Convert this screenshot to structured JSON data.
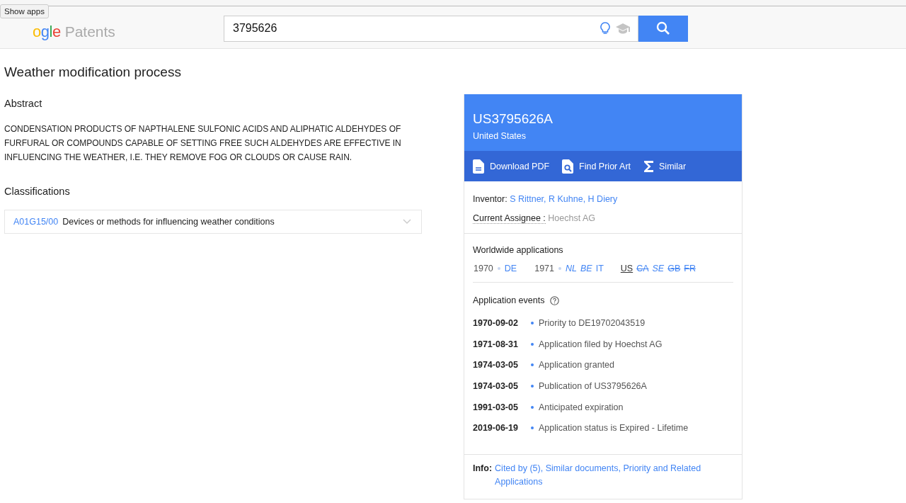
{
  "header": {
    "tooltip": "Show apps",
    "logo_letters": [
      {
        "ch": "o",
        "color": "#fbbc05"
      },
      {
        "ch": "g",
        "color": "#4285f4"
      },
      {
        "ch": "l",
        "color": "#34a853"
      },
      {
        "ch": "e",
        "color": "#ea4335"
      }
    ],
    "product": "Patents",
    "search": {
      "value": "3795626"
    }
  },
  "title": "Weather modification process",
  "abstract": {
    "heading": "Abstract",
    "text": "CONDENSATION PRODUCTS OF NAPTHALENE SULFONIC ACIDS AND ALIPHATIC ALDEHYDES OF FURFURAL OR COMPOUNDS CAPABLE OF SETTING FREE SUCH ALDEHYDES ARE EFFECTIVE IN INFLUENCING THE WEATHER, I.E. THEY REMOVE FOG OR CLOUDS OR CAUSE RAIN."
  },
  "classifications": {
    "heading": "Classifications",
    "items": [
      {
        "code": "A01G15/00",
        "text": "Devices or methods for influencing weather conditions",
        "expanded": false
      }
    ]
  },
  "card": {
    "number": "US3795626A",
    "country": "United States",
    "actions": [
      {
        "kind": "pdf",
        "label": "Download PDF"
      },
      {
        "kind": "prior",
        "label": "Find Prior Art"
      },
      {
        "kind": "similar",
        "label": "Similar"
      }
    ],
    "inventor_label": "Inventor:",
    "inventors": "S Rittner, R Kuhne, H Diery",
    "assignee_label": "Current Assignee :",
    "assignee": "Hoechst AG",
    "worldwide_heading": "Worldwide applications",
    "years": [
      {
        "year": "1970",
        "countries": [
          {
            "code": "DE",
            "kind": "active"
          }
        ]
      },
      {
        "year": "1971",
        "countries": [
          {
            "code": "NL",
            "kind": "pending"
          },
          {
            "code": "BE",
            "kind": "pending"
          },
          {
            "code": "IT",
            "kind": "active"
          },
          {
            "code": "US",
            "kind": "current"
          },
          {
            "code": "CA",
            "kind": "expired"
          },
          {
            "code": "SE",
            "kind": "pending"
          },
          {
            "code": "GB",
            "kind": "expired"
          },
          {
            "code": "FR",
            "kind": "expired"
          }
        ]
      }
    ],
    "events_heading": "Application events",
    "events": [
      {
        "date": "1970-09-02",
        "text": "Priority to DE19702043519"
      },
      {
        "date": "1971-08-31",
        "text": "Application filed by Hoechst AG"
      },
      {
        "date": "1974-03-05",
        "text": "Application granted"
      },
      {
        "date": "1974-03-05",
        "text": "Publication of US3795626A"
      },
      {
        "date": "1991-03-05",
        "text": "Anticipated expiration"
      },
      {
        "date": "2019-06-19",
        "text": "Application status is Expired - Lifetime"
      }
    ],
    "info_label": "Info:",
    "info_links": "Cited by (5), Similar documents, Priority and Related Applications"
  }
}
